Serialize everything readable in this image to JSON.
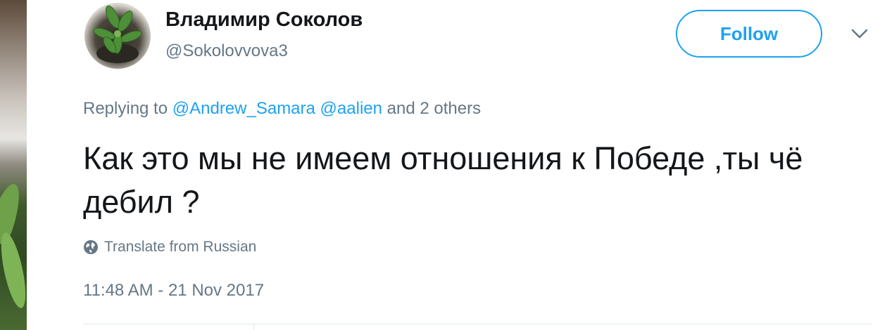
{
  "user": {
    "display_name": "Владимир Соколов",
    "handle": "@Sokolovvova3",
    "avatar_icon": "plant-avatar"
  },
  "actions": {
    "follow_label": "Follow",
    "caret_icon": "chevron-down-icon"
  },
  "reply": {
    "prefix": "Replying to",
    "mentions": [
      "@Andrew_Samara",
      "@aalien"
    ],
    "suffix": "and 2 others"
  },
  "tweet": {
    "text": "Как это мы не имеем отношения к Победе ,ты чё дебил ?",
    "translate_label": "Translate from Russian",
    "translate_icon": "globe-icon",
    "timestamp": "11:48 AM - 21 Nov 2017"
  },
  "colors": {
    "accent": "#1da1f2",
    "secondary_text": "#657786",
    "primary_text": "#14171a"
  }
}
